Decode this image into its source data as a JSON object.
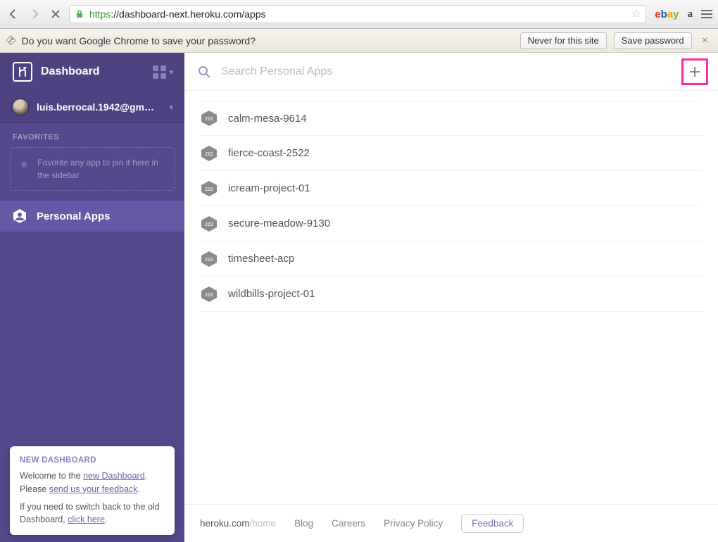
{
  "browser": {
    "url_proto": "https",
    "url_rest": "://dashboard-next.heroku.com/apps",
    "amazon_glyph": "a"
  },
  "password_bar": {
    "prompt": "Do you want Google Chrome to save your password?",
    "never": "Never for this site",
    "save": "Save password"
  },
  "sidebar": {
    "title": "Dashboard",
    "user_email": "luis.berrocal.1942@gmail....",
    "favorites_label": "FAVORITES",
    "favorites_hint": "Favorite any app to pin it here in the sidebar",
    "personal_apps": "Personal Apps"
  },
  "notice": {
    "heading": "NEW DASHBOARD",
    "line1_pre": "Welcome to the ",
    "line1_link": "new Dashboard",
    "line1_post": ". Please ",
    "line1_link2": "send us your feedback",
    "line1_end": ".",
    "line2_pre": "If you need to switch back to the old Dashboard, ",
    "line2_link": "click here",
    "line2_end": "."
  },
  "search": {
    "placeholder": "Search Personal Apps"
  },
  "apps": [
    {
      "name": "calm-mesa-9614"
    },
    {
      "name": "fierce-coast-2522"
    },
    {
      "name": "icream-project-01"
    },
    {
      "name": "secure-meadow-9130"
    },
    {
      "name": "timesheet-acp"
    },
    {
      "name": "wildbills-project-01"
    }
  ],
  "footer": {
    "brand_main": "heroku.com",
    "brand_dim": "/home",
    "blog": "Blog",
    "careers": "Careers",
    "privacy": "Privacy Policy",
    "feedback": "Feedback"
  }
}
